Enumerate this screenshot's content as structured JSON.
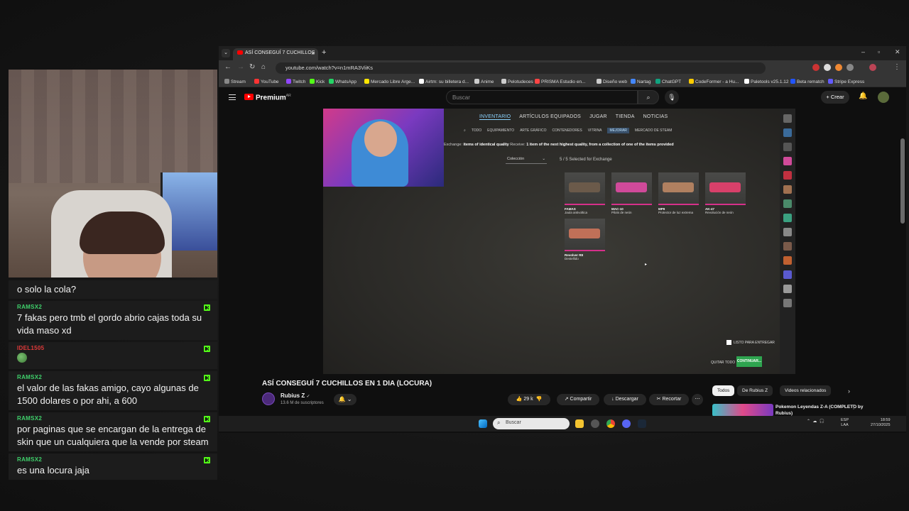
{
  "chat": {
    "messages": [
      {
        "user": "",
        "text": "o solo la cola?"
      },
      {
        "user": "RAMSX2",
        "text": "7 fakas pero tmb el gordo abrio cajas toda su vida maso xd"
      },
      {
        "user": "IDEL1505",
        "text": ""
      },
      {
        "user": "RAMSX2",
        "text": "el valor de las fakas amigo, cayo algunas de 1500 dolares o por ahi, a 600"
      },
      {
        "user": "RAMSX2",
        "text": "por paginas que se encargan de la entrega de skin que un cualquiera que la vende por steam"
      },
      {
        "user": "RAMSX2",
        "text": "es una locura jaja"
      }
    ]
  },
  "browser": {
    "tab_title": "ASÍ CONSEGUÍ 7 CUCHILLOS",
    "url": "youtube.com/watch?v=n1mRA3ViiKs",
    "bookmarks": [
      "Stream",
      "YouTube",
      "Twitch",
      "Kick",
      "WhatsApp",
      "Mercado Libre Arge...",
      "Airtm: su billetera d...",
      "Anime",
      "Pelotudeces",
      "PRISMA Estudio en...",
      "Diseño web",
      "Nartag",
      "ChatGPT",
      "CodeFormer - a Hu...",
      "Paletools v25.1.12",
      "Beta rematch",
      "Stripe Express"
    ],
    "bookmark_colors": [
      "#888888",
      "#ff3333",
      "#9146ff",
      "#53fc18",
      "#25d366",
      "#ffe600",
      "#ffffff",
      "#cccccc",
      "#cccccc",
      "#ff4444",
      "#cccccc",
      "#4488ff",
      "#10a37f",
      "#ffcc00",
      "#ffffff",
      "#2255ff",
      "#635bff"
    ]
  },
  "youtube": {
    "logo": "Premium",
    "region": "AR",
    "search_placeholder": "Buscar",
    "create_label": "Crear",
    "video_title": "ASÍ CONSEGUÍ 7 CUCHILLOS EN 1 DIA (LOCURA)",
    "channel_name": "Rubius Z",
    "subscribers": "13.6 M de suscriptores",
    "likes": "29 k",
    "share": "Compartir",
    "download": "Descargar",
    "clip": "Recortar",
    "chips": [
      "Todos",
      "De Rubius Z",
      "Videos relacionados"
    ],
    "recommended_title": "Pokemon Leyendas Z-A (COMPLETO by Rubius)"
  },
  "game": {
    "nav": [
      "INVENTARIO",
      "ARTÍCULOS EQUIPADOS",
      "JUGAR",
      "TIENDA",
      "NOTICIAS"
    ],
    "subnav": [
      "TODO",
      "EQUIPAMIENTO",
      "ARTE GRÁFICO",
      "CONTENEDORES",
      "VITRINA",
      "MEJORAR",
      "MERCADO DE STEAM"
    ],
    "exchange_label": "Exchange:",
    "exchange_give": "items of identical quality",
    "receive_label": "Receive:",
    "exchange_receive": "1 item of the next highest quality, from a collection of one of the items provided",
    "dropdown": "Colección",
    "selected": "5 / 5 Selected for Exchange",
    "items": [
      {
        "name": "FAMAS",
        "skin": "Jaula antivoltica",
        "color": "#6b5a4a"
      },
      {
        "name": "MAC-10",
        "skin": "Pilots de neón",
        "color": "#d04a9a"
      },
      {
        "name": "MP9",
        "skin": "Protector de luz extrema",
        "color": "#b08060"
      },
      {
        "name": "AK-47",
        "skin": "Revolución de neón",
        "color": "#d8406a"
      },
      {
        "name": "Revolver R8",
        "skin": "Destellido",
        "color": "#c07058"
      }
    ],
    "ready_label": "LISTO PARA ENTREGAR",
    "remove_all": "QUITAR TODO",
    "continue": "CONTINUAR..."
  },
  "taskbar": {
    "search": "Buscar",
    "lang_top": "ESP",
    "lang_bottom": "LAA",
    "time": "18:59",
    "date": "27/10/2025"
  }
}
